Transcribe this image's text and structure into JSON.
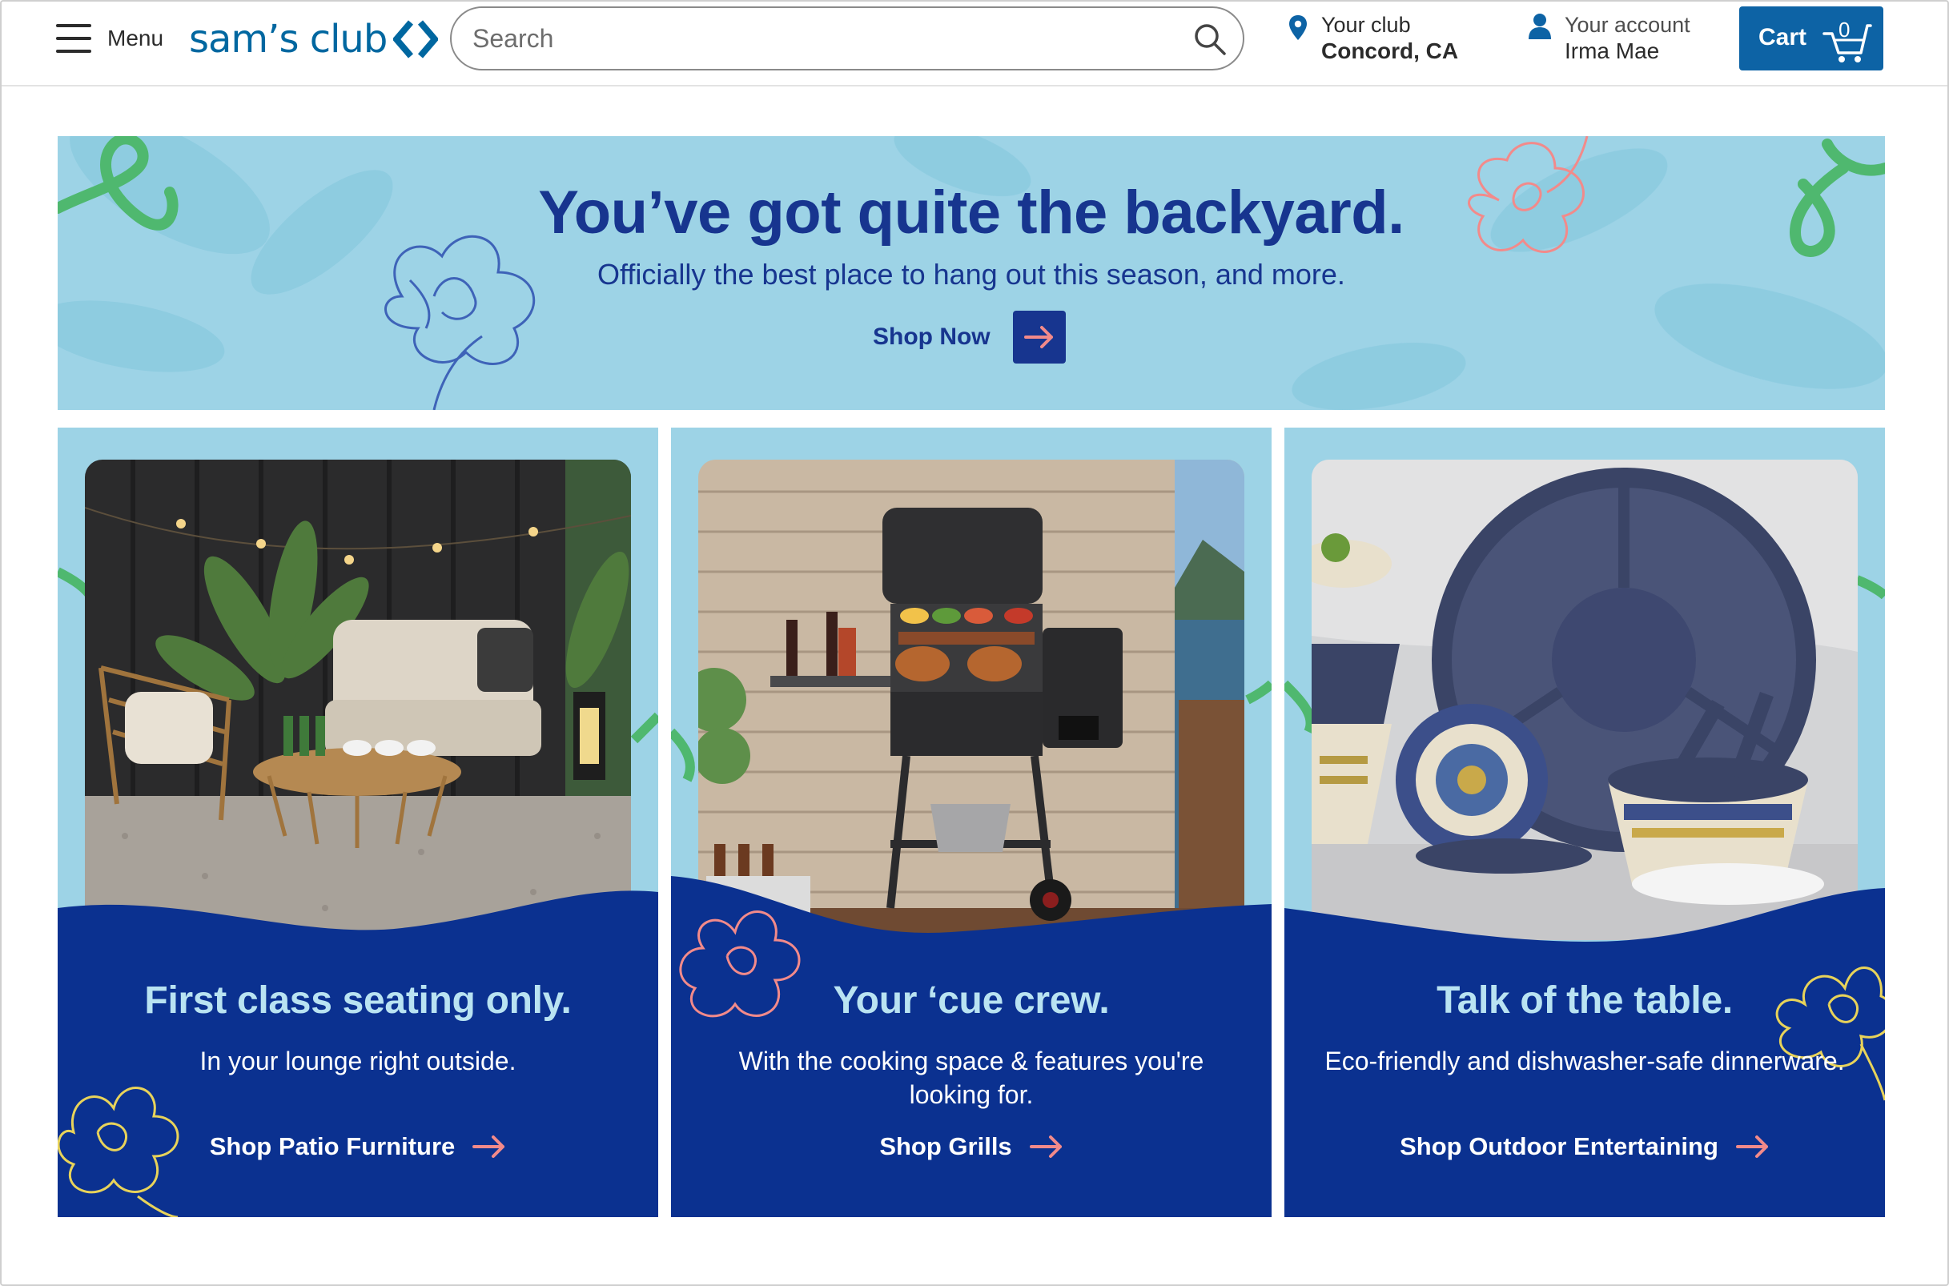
{
  "header": {
    "menu_label": "Menu",
    "logo_text": "sam’s club",
    "search": {
      "placeholder": "Search",
      "value": ""
    },
    "club": {
      "label": "Your club",
      "name": "Concord, CA"
    },
    "account": {
      "label": "Your account",
      "name": "Irma Mae"
    },
    "cart": {
      "label": "Cart",
      "count": "0"
    }
  },
  "hero": {
    "title": "You’ve got quite the backyard.",
    "subtitle": "Officially the best place to hang out this season, and more.",
    "cta_label": "Shop Now"
  },
  "cards": [
    {
      "title": "First class seating only.",
      "description": "In your lounge right outside.",
      "link_label": "Shop Patio Furniture"
    },
    {
      "title": "Your ‘cue crew.",
      "description": "With the cooking space & features you're looking for.",
      "link_label": "Shop Grills"
    },
    {
      "title": "Talk of the table.",
      "description": "Eco-friendly and dishwasher-safe dinnerware.",
      "link_label": "Shop Outdoor Entertaining"
    }
  ],
  "icons": {
    "menu": "hamburger-icon",
    "search": "search-icon",
    "location": "location-pin-icon",
    "account": "user-icon",
    "cart": "cart-icon",
    "arrow": "arrow-right-icon"
  },
  "colors": {
    "brand_blue": "#0067a0",
    "cart_blue": "#0d63a5",
    "navy": "#0b3190",
    "sky": "#9dd3e6",
    "accent_pink": "#f28a8a",
    "accent_green": "#4fb86f",
    "accent_yellow": "#e8d35a"
  }
}
